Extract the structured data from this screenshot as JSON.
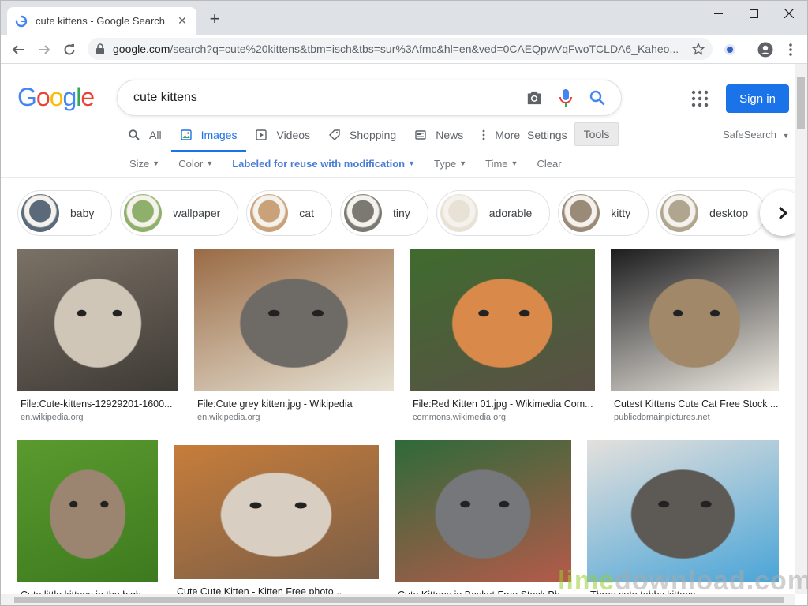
{
  "browser": {
    "tab_title": "cute kittens - Google Search",
    "new_tab": "+",
    "url_host": "google.com",
    "url_path": "/search?q=cute%20kittens&tbm=isch&tbs=sur%3Afmc&hl=en&ved=0CAEQpwVqFwoTCLDA6_Kaheo..."
  },
  "header": {
    "logo_letters": [
      "G",
      "o",
      "o",
      "g",
      "l",
      "e"
    ],
    "logo_colors": [
      "#4285f4",
      "#ea4335",
      "#fbbc05",
      "#4285f4",
      "#34a853",
      "#ea4335"
    ],
    "query": "cute kittens",
    "signin_label": "Sign in",
    "accent": "#1a73e8"
  },
  "search_tabs": [
    {
      "label": "All",
      "icon": "search-icon"
    },
    {
      "label": "Images",
      "icon": "image-icon",
      "active": true
    },
    {
      "label": "Videos",
      "icon": "video-icon"
    },
    {
      "label": "Shopping",
      "icon": "tag-icon"
    },
    {
      "label": "News",
      "icon": "news-icon"
    },
    {
      "label": "More",
      "icon": "more-vert-icon"
    }
  ],
  "settings_label": "Settings",
  "tools_label": "Tools",
  "safesearch_label": "SafeSearch",
  "filters": [
    {
      "label": "Size"
    },
    {
      "label": "Color"
    },
    {
      "label": "Labeled for reuse with modification",
      "selected": true
    },
    {
      "label": "Type"
    },
    {
      "label": "Time"
    },
    {
      "label": "Clear",
      "no_caret": true
    }
  ],
  "chips": [
    {
      "label": "baby",
      "color": "#5a6a7a"
    },
    {
      "label": "wallpaper",
      "color": "#8fb06a"
    },
    {
      "label": "cat",
      "color": "#c9a27a"
    },
    {
      "label": "tiny",
      "color": "#7a7a72"
    },
    {
      "label": "adorable",
      "color": "#e8e2d6"
    },
    {
      "label": "kitty",
      "color": "#9a8a78"
    },
    {
      "label": "desktop",
      "color": "#b0a58e"
    }
  ],
  "results": [
    {
      "caption": "File:Cute-kittens-12929201-1600...",
      "source": "en.wikipedia.org",
      "colors": [
        "#7b7166",
        "#cfc6b8",
        "#3e3a35"
      ]
    },
    {
      "caption": "File:Cute grey kitten.jpg - Wikipedia",
      "source": "en.wikipedia.org",
      "colors": [
        "#9a6b45",
        "#6e6a66",
        "#e7e2d4"
      ]
    },
    {
      "caption": "File:Red Kitten 01.jpg - Wikimedia Com...",
      "source": "commons.wikimedia.org",
      "colors": [
        "#3f6b2e",
        "#d98a4a",
        "#5a5046"
      ]
    },
    {
      "caption": "Cutest Kittens Cute Cat Free Stock ...",
      "source": "publicdomainpictures.net",
      "colors": [
        "#1d1d1f",
        "#a08868",
        "#f0ece4"
      ]
    },
    {
      "caption": "Cute little kittens in the high grass...",
      "source": "",
      "colors": [
        "#5a9a2e",
        "#9b8470",
        "#3d7a1f"
      ]
    },
    {
      "caption": "Cute Cute Kitten - Kitten Free photo...",
      "source": "",
      "colors": [
        "#c77d3a",
        "#d8cfc2",
        "#7a5e48"
      ]
    },
    {
      "caption": "Cute Kittens in Basket Free Stock Photo...",
      "source": "",
      "colors": [
        "#2e6a3a",
        "#75777a",
        "#b45a4a"
      ]
    },
    {
      "caption": "Three cute tabby kittens...",
      "source": "",
      "colors": [
        "#e4e0dc",
        "#5d5a56",
        "#4aa5d8"
      ]
    }
  ],
  "watermark": {
    "part1": "lime",
    "part2": "download.com"
  }
}
